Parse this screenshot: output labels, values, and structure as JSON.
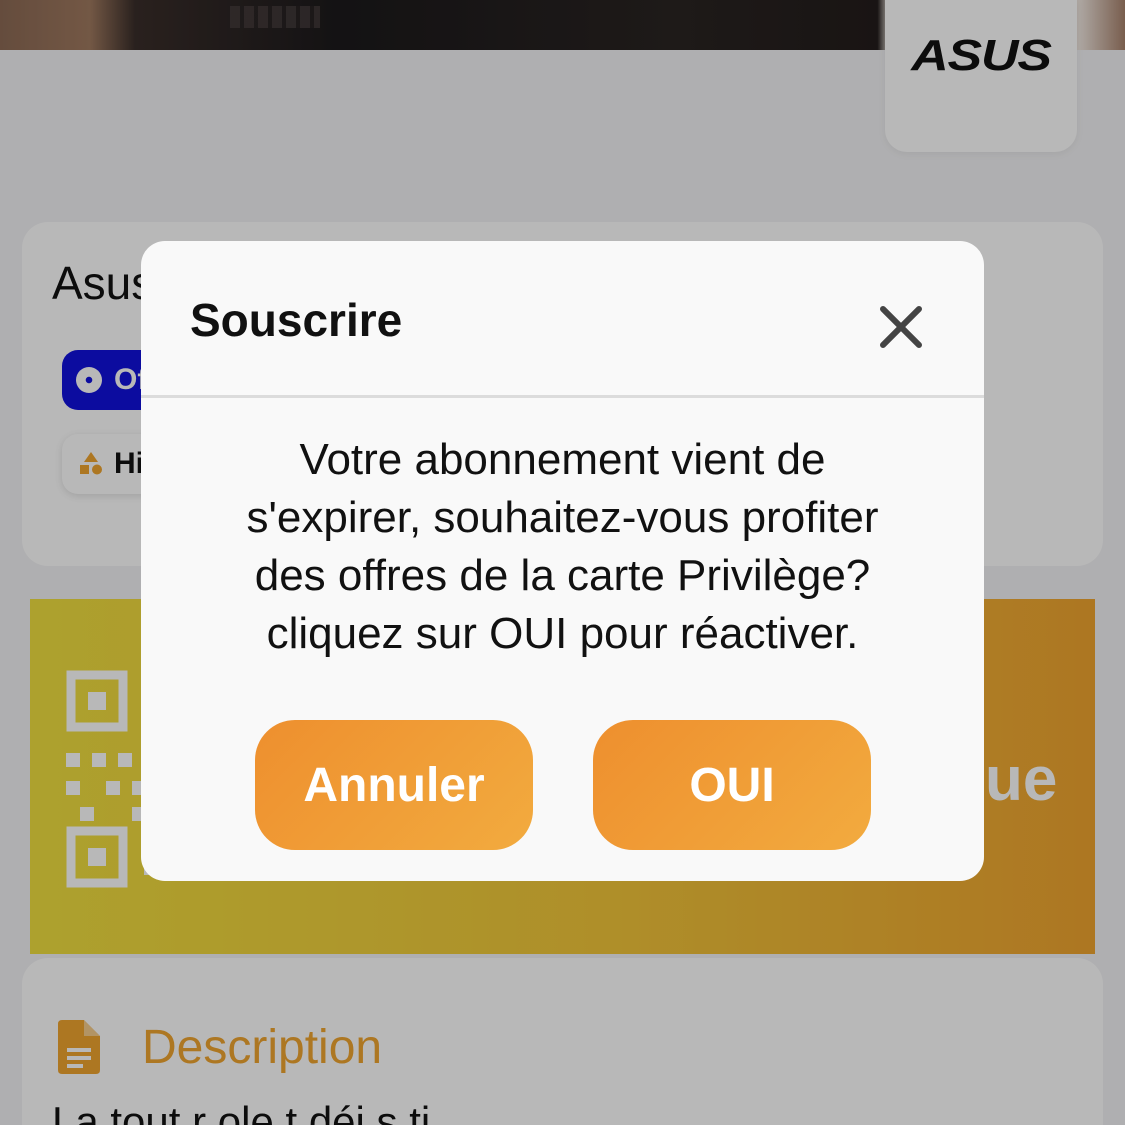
{
  "hero": {
    "brand": "ASUS"
  },
  "product": {
    "title": "Asus",
    "chip_primary": "Of",
    "chip_secondary": "Hi"
  },
  "banner": {
    "text_fragment": "ue"
  },
  "description": {
    "title": "Description",
    "body_fragment": "La tout   r      ole  t     déi       s         ti"
  },
  "modal": {
    "title": "Souscrire",
    "message_lines": [
      "Votre abonnement vient de",
      "s'expirer, souhaitez-vous profiter",
      "des offres de la carte Privilège?",
      "cliquez sur OUI pour réactiver."
    ],
    "cancel_label": "Annuler",
    "ok_label": "OUI"
  },
  "colors": {
    "accent_orange": "#f0a530",
    "chip_blue": "#1111dd",
    "button_gradient_start": "#ee8f2e",
    "button_gradient_end": "#f2ab3f"
  }
}
